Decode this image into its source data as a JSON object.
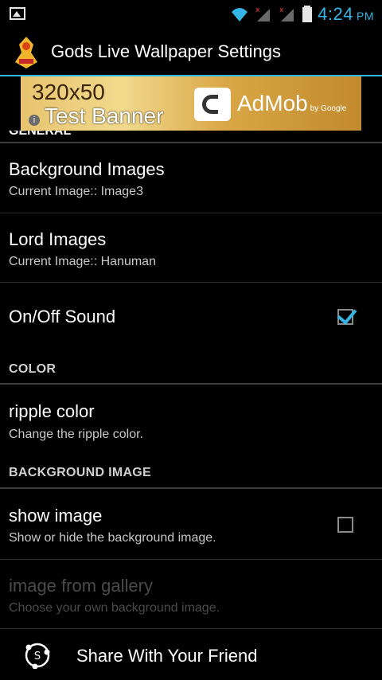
{
  "status_bar": {
    "time": "4:24",
    "ampm": "PM",
    "icons": [
      "image-icon",
      "wifi-icon",
      "signal-icon",
      "signal-icon",
      "battery-icon"
    ]
  },
  "action_bar": {
    "title": "Gods Live Wallpaper Settings",
    "icon": "app-icon"
  },
  "ad": {
    "line1": "320x50",
    "line2": "Test Banner",
    "brand": "AdMob",
    "brand_suffix": "by Google",
    "info": "i"
  },
  "preferences": {
    "general_header": "GENERAL",
    "background_images": {
      "title": "Background Images",
      "summary": "Current Image:: Image3"
    },
    "lord_images": {
      "title": "Lord Images",
      "summary": "Current Image:: Hanuman"
    },
    "sound": {
      "title": "On/Off Sound",
      "checked": true
    },
    "color_header": "COLOR",
    "ripple_color": {
      "title": "ripple color",
      "summary": "Change the ripple color."
    },
    "bg_header": "BACKGROUND IMAGE",
    "show_image": {
      "title": "show image",
      "summary": "Show or hide the background image.",
      "checked": false
    },
    "gallery": {
      "title": "image from gallery",
      "summary": "Choose your own background image.",
      "enabled": false
    }
  },
  "share": {
    "label": "Share With Your Friend"
  },
  "colors": {
    "accent": "#33b5e5",
    "background": "#000000"
  }
}
